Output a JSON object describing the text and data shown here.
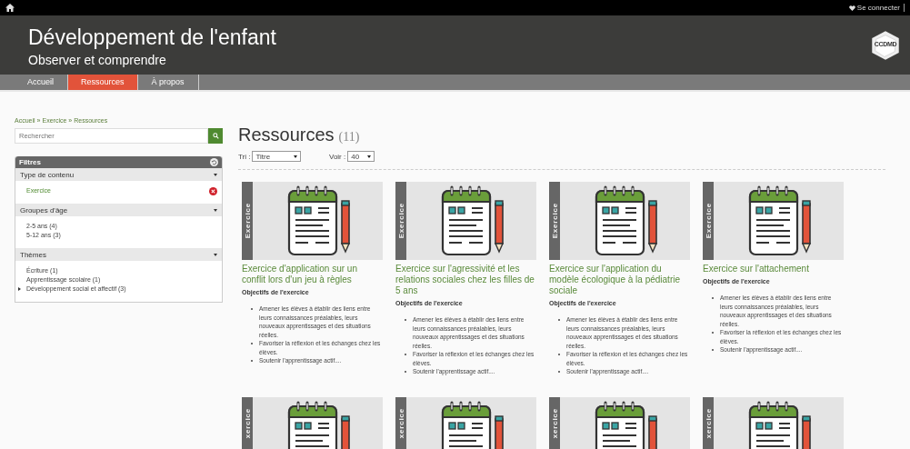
{
  "topbar": {
    "login": "Se connecter"
  },
  "header": {
    "title": "Développement de l'enfant",
    "subtitle": "Observer et comprendre",
    "logo": "CCDMD"
  },
  "nav": [
    {
      "label": "Accueil",
      "selected": false
    },
    {
      "label": "Ressources",
      "selected": true
    },
    {
      "label": "À propos",
      "selected": false
    }
  ],
  "breadcrumb": {
    "separator": "»",
    "items": [
      "Accueil",
      "Exercice",
      "Ressources"
    ]
  },
  "search": {
    "placeholder": "Rechercher"
  },
  "filters": {
    "title": "Filtres",
    "groups": [
      {
        "title": "Type de contenu",
        "expanded": true,
        "items": [
          {
            "label": "Exercice",
            "selected": true,
            "expandable": false
          }
        ]
      },
      {
        "title": "Groupes d'âge",
        "expanded": true,
        "items": [
          {
            "label": "2-5 ans (4)",
            "selected": false,
            "expandable": false
          },
          {
            "label": "5-12 ans (3)",
            "selected": false,
            "expandable": false
          }
        ]
      },
      {
        "title": "Thèmes",
        "expanded": true,
        "items": [
          {
            "label": "Écriture (1)",
            "selected": false,
            "expandable": false
          },
          {
            "label": "Apprentissage scolaire (1)",
            "selected": false,
            "expandable": false
          },
          {
            "label": "Développement social et affectif (3)",
            "selected": false,
            "expandable": true
          }
        ]
      }
    ]
  },
  "main": {
    "heading": "Ressources",
    "count": "(11)",
    "sort": {
      "label": "Tri :",
      "value": "Titre"
    },
    "per_page": {
      "label": "Voir :",
      "value": "40"
    }
  },
  "cards": [
    {
      "label": "Exercice",
      "title": "Exercice d'application sur un conflit lors d'un jeu à règles",
      "subtitle": "Objectifs de l'exercice",
      "bullets": [
        "Amener les élèves à établir des liens entre leurs connaissances préalables, leurs nouveaux apprentissages et des situations réelles.",
        "Favoriser la réflexion et les échanges chez les élèves.",
        "Soutenir l'apprentissage actif...."
      ]
    },
    {
      "label": "Exercice",
      "title": "Exercice sur l'agressivité et les relations sociales chez les filles de 5 ans",
      "subtitle": "Objectifs de l'exercice",
      "bullets": [
        "Amener les élèves à établir des liens entre leurs connaissances préalables, leurs nouveaux apprentissages et des situations réelles.",
        "Favoriser la réflexion et les échanges chez les élèves.",
        "Soutenir l'apprentissage actif...."
      ]
    },
    {
      "label": "Exercice",
      "title": "Exercice sur l'application du modèle écologique à la pédiatrie sociale",
      "subtitle": "Objectifs de l'exercice",
      "bullets": [
        "Amener les élèves à établir des liens entre leurs connaissances préalables, leurs nouveaux apprentissages et des situations réelles.",
        "Favoriser la réflexion et les échanges chez les élèves.",
        "Soutenir l'apprentissage actif...."
      ]
    },
    {
      "label": "Exercice",
      "title": "Exercice sur l'attachement",
      "subtitle": "Objectifs de l'exercice",
      "bullets": [
        "Amener les élèves à établir des liens entre leurs connaissances préalables, leurs nouveaux apprentissages et des situations réelles.",
        "Favoriser la réflexion et les échanges chez les élèves.",
        "Soutenir l'apprentissage actif...."
      ]
    },
    {
      "label": "xercice"
    },
    {
      "label": "xercice"
    },
    {
      "label": "xercice"
    },
    {
      "label": "xercice"
    }
  ]
}
